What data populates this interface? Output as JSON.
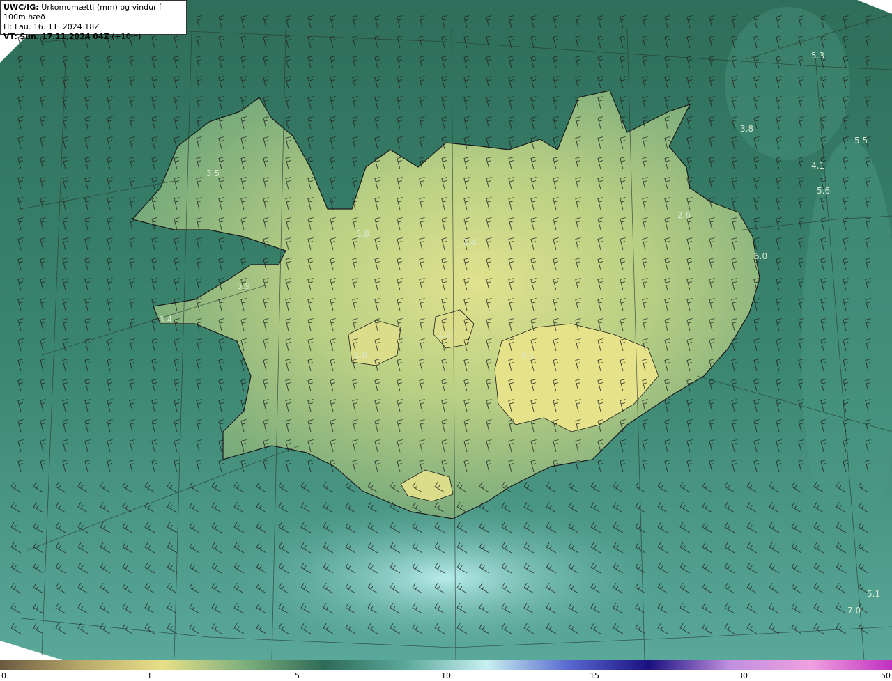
{
  "header": {
    "code": "UWC/IG:",
    "title": "Úrkomumætti (mm) og vindur í 100m hæð",
    "it_label": "IT:",
    "it_value": "Lau. 16. 11. 2024 18Z",
    "vt_label": "VT:",
    "vt_value": "Sun. 17.11.2024 04Z",
    "vt_offset": "(+10 h)"
  },
  "colors": {
    "sea_dark": "#2e6b58",
    "sea_mid": "#3f8a72",
    "land_yellow": "#c9d98a",
    "land_green": "#7fb07c",
    "cyan": "#9ed8d4",
    "coast": "#1a1a1a",
    "grid": "#2a3a34"
  },
  "colorbar": {
    "ticks": [
      "0",
      "1",
      "5",
      "10",
      "15",
      "30",
      "50"
    ],
    "colors": [
      "#6b5a40",
      "#b8a86a",
      "#e8e088",
      "#7fb07c",
      "#2e6b58",
      "#5aa89a",
      "#c8f0f0",
      "#5a6ad0",
      "#1a1080",
      "#c090e0",
      "#f0a0e0",
      "#c030c0"
    ]
  },
  "values": [
    "5.3",
    "3.8",
    "5.5",
    "4.1",
    "5.6",
    "3.5",
    "2.6",
    "5.8",
    "2.4",
    "6.0",
    "5.9",
    "3.4",
    "1.2",
    "1.1",
    "1.0",
    "5.1",
    "7.0"
  ]
}
